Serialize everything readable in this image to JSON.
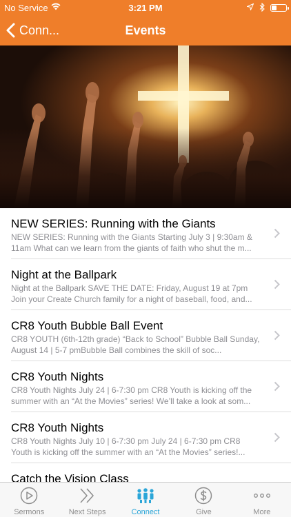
{
  "status_bar": {
    "carrier": "No Service",
    "time": "3:21 PM"
  },
  "nav": {
    "back_label": "Conn...",
    "title": "Events"
  },
  "colors": {
    "brand_orange": "#ef7e2a",
    "active_tab": "#2ba6d8",
    "inactive_tab": "#8e8e8e"
  },
  "events": [
    {
      "title": "NEW SERIES: Running with the Giants",
      "description": "NEW SERIES: Running with the Giants Starting July 3 | 9:30am & 11am What can we learn from the giants of faith who shut the m..."
    },
    {
      "title": "Night at the Ballpark",
      "description": "Night at the Ballpark SAVE THE DATE: Friday, August 19 at 7pm Join your Create Church family for a night of baseball, food, and..."
    },
    {
      "title": "CR8 Youth Bubble Ball Event",
      "description": "CR8 YOUTH (6th-12th grade) “Back to School” Bubble Ball Sunday, August 14 | 5-7 pmBubble Ball combines the skill of soc..."
    },
    {
      "title": "CR8 Youth Nights",
      "description": "CR8 Youth Nights July 24 | 6-7:30 pm CR8 Youth is kicking off the summer with an “At the Movies” series! We’ll take a look at som..."
    },
    {
      "title": "CR8 Youth Nights",
      "description": "CR8 Youth Nights July 10 | 6-7:30 pm July 24 | 6-7:30 pm CR8 Youth is kicking off the summer with an “At the Movies” series!..."
    },
    {
      "title": "Catch the Vision Class",
      "description": ""
    }
  ],
  "tabs": [
    {
      "label": "Sermons",
      "icon": "play-circle-icon"
    },
    {
      "label": "Next Steps",
      "icon": "double-chevron-icon"
    },
    {
      "label": "Connect",
      "icon": "people-icon"
    },
    {
      "label": "Give",
      "icon": "dollar-circle-icon"
    },
    {
      "label": "More",
      "icon": "ellipsis-icon"
    }
  ]
}
